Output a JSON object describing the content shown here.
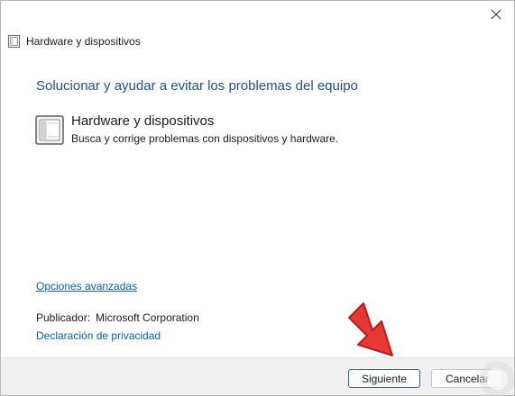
{
  "window": {
    "close_glyph": "✕"
  },
  "header": {
    "title": "Hardware y dispositivos",
    "icon": "hardware-device-icon"
  },
  "main": {
    "heading": "Solucionar y ayudar a evitar los problemas del equipo",
    "task": {
      "title": "Hardware y dispositivos",
      "description": "Busca y corrige problemas con dispositivos y hardware.",
      "icon": "hardware-device-icon"
    },
    "advanced_link": "Opciones avanzadas",
    "publisher_label": "Publicador:",
    "publisher_value": "Microsoft Corporation",
    "privacy_link": "Declaración de privacidad"
  },
  "footer": {
    "next_label": "Siguiente",
    "cancel_label": "Cancelar"
  },
  "colors": {
    "heading": "#1f4e96",
    "link": "#0b5ea8",
    "arrow": "#e53935",
    "footer_bg": "#f0f0f0"
  }
}
